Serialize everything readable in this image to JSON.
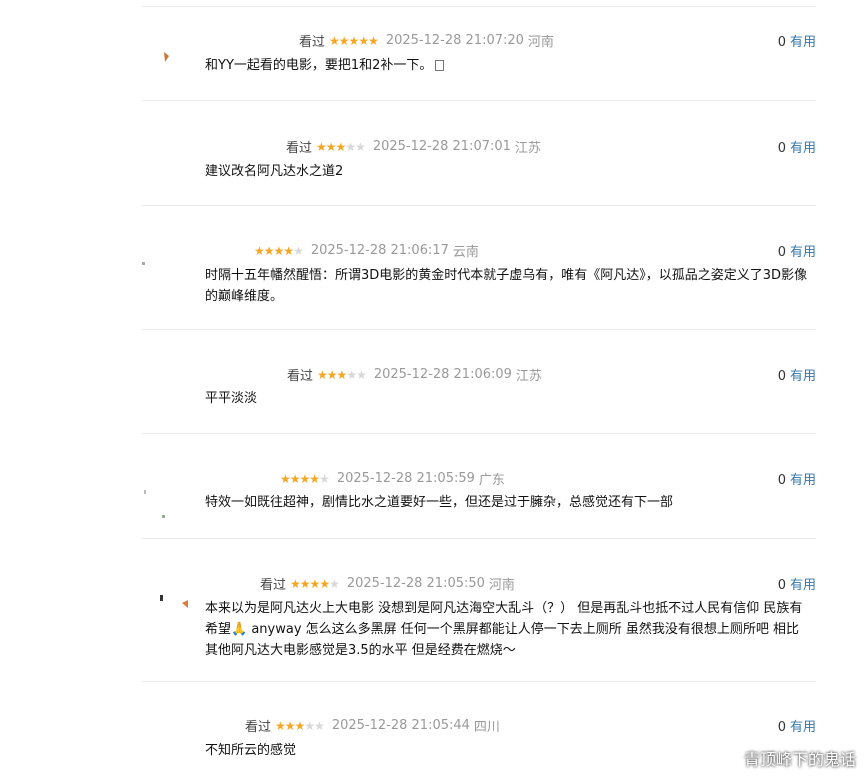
{
  "comments": [
    {
      "status": "看过",
      "rating": 5,
      "time": "2025-12-28 21:07:20",
      "location": "河南",
      "votes": "0",
      "useful": "有用",
      "content": "和YY一起看的电影，要把1和2补一下。"
    },
    {
      "status": "看过",
      "rating": 3,
      "time": "2025-12-28 21:07:01",
      "location": "江苏",
      "votes": "0",
      "useful": "有用",
      "content": "建议改名阿凡达水之道2"
    },
    {
      "status": "",
      "rating": 4,
      "time": "2025-12-28 21:06:17",
      "location": "云南",
      "votes": "0",
      "useful": "有用",
      "content": "时隔十五年幡然醒悟：所谓3D电影的黄金时代本就子虚乌有，唯有《阿凡达》，以孤品之姿定义了3D影像的巅峰维度。"
    },
    {
      "status": "看过",
      "rating": 3,
      "time": "2025-12-28 21:06:09",
      "location": "江苏",
      "votes": "0",
      "useful": "有用",
      "content": "平平淡淡"
    },
    {
      "status": "",
      "rating": 4,
      "time": "2025-12-28 21:05:59",
      "location": "广东",
      "votes": "0",
      "useful": "有用",
      "content": "特效一如既往超神，剧情比水之道要好一些，但还是过于臃杂，总感觉还有下一部"
    },
    {
      "status": "看过",
      "rating": 4,
      "time": "2025-12-28 21:05:50",
      "location": "河南",
      "votes": "0",
      "useful": "有用",
      "content": "本来以为是阿凡达火上大电影 没想到是阿凡达海空大乱斗（？） 但是再乱斗也抵不过人民有信仰 民族有希望🙏 anyway 怎么这么多黑屏 任何一个黑屏都能让人停一下去上厕所 虽然我没有很想上厕所吧 相比其他阿凡达大电影感觉是3.5的水平 但是经费在燃烧～"
    },
    {
      "status": "看过",
      "rating": 3,
      "time": "2025-12-28 21:05:44",
      "location": "四川",
      "votes": "0",
      "useful": "有用",
      "content": "不知所云的感觉"
    }
  ],
  "watermark": "青顶峰下的鬼话",
  "colors": {
    "star_on": "#f5a623",
    "star_off": "#d8d8d8",
    "link": "#3377aa"
  }
}
